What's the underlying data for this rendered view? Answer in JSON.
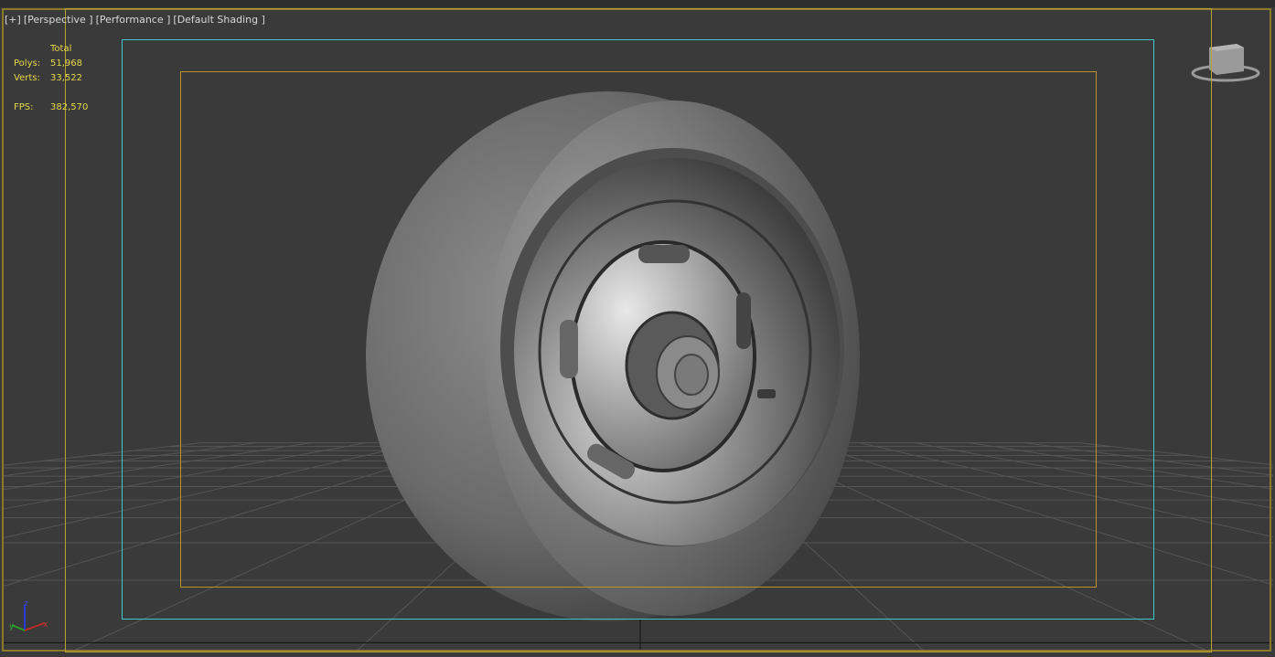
{
  "viewport": {
    "labels": [
      "[+]",
      "[Perspective ]",
      "[Performance ]",
      "[Default Shading ]"
    ]
  },
  "stats": {
    "header": "Total",
    "rows": [
      {
        "key": "Polys:",
        "value": "51,968"
      },
      {
        "key": "Verts:",
        "value": "33,522"
      },
      {
        "key": "FPS:",
        "value": "382,570"
      }
    ]
  },
  "axis_gizmo": {
    "z": "z",
    "x": "x",
    "y": "y"
  },
  "colors": {
    "safe_frame_outer": "#b8a230",
    "safe_frame_action": "#3fc6c6",
    "safe_frame_title": "#b8922a",
    "stats_text": "#e6d84a"
  }
}
